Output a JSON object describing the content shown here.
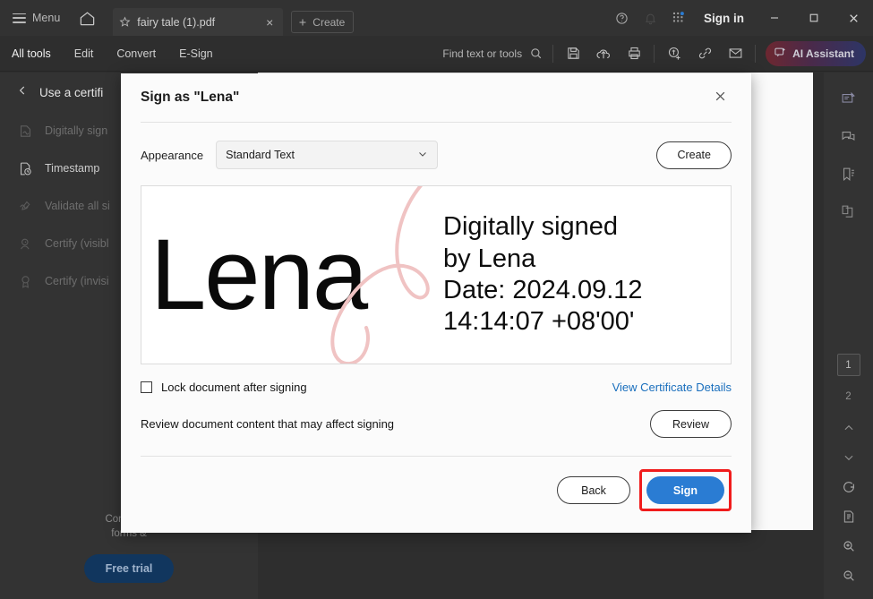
{
  "titlebar": {
    "menu_label": "Menu",
    "home_icon": "home-icon",
    "star_icon": "star-icon",
    "tab_title": "fairy tale (1).pdf",
    "tab_close": "×",
    "create_label": "Create",
    "help_icon": "help-circle-icon",
    "bell_icon": "bell-icon",
    "apps_icon": "apps-grid-icon",
    "signin_label": "Sign in",
    "minimize": "–",
    "maximize": "□",
    "close": "✕"
  },
  "toolbar": {
    "tabs": [
      {
        "label": "All tools",
        "active": true
      },
      {
        "label": "Edit",
        "active": false
      },
      {
        "label": "Convert",
        "active": false
      },
      {
        "label": "E-Sign",
        "active": false
      }
    ],
    "find_placeholder": "Find text or tools",
    "search_icon": "search-icon",
    "icons": [
      "save-icon",
      "upload-cloud-icon",
      "print-icon",
      "add-stamp-icon",
      "link-icon",
      "email-icon"
    ],
    "ai_label": "AI Assistant",
    "ai_icon": "ai-sparkle-icon"
  },
  "left_panel": {
    "back_icon": "chevron-left-icon",
    "title": "Use a certifi",
    "items": [
      {
        "label": "Digitally sign",
        "icon": "digital-sign-icon",
        "dim": true
      },
      {
        "label": "Timestamp",
        "icon": "timestamp-icon",
        "dim": false
      },
      {
        "label": "Validate all si",
        "icon": "validate-icon",
        "dim": true
      },
      {
        "label": "Certify (visibl",
        "icon": "certify-visible-icon",
        "dim": true
      },
      {
        "label": "Certify (invisi",
        "icon": "certify-invisible-icon",
        "dim": true
      }
    ],
    "promo_line1": "Convert, e",
    "promo_line2": "forms & ",
    "free_trial_label": "Free trial"
  },
  "right_rail": {
    "top_icons": [
      "edit-note-icon",
      "comment-icon",
      "bookmark-icon",
      "page-thumbnails-icon"
    ],
    "pages": [
      {
        "number": "1",
        "selected": true
      },
      {
        "number": "2",
        "selected": false
      }
    ],
    "prev_icon": "chevron-up-icon",
    "next_icon": "chevron-down-icon",
    "rotate_icon": "rotate-icon",
    "fitpage_icon": "fit-page-icon",
    "zoom_in_icon": "zoom-in-icon",
    "zoom_out_icon": "zoom-out-icon"
  },
  "modal": {
    "title": "Sign as \"Lena\"",
    "close_icon": "close-icon",
    "appearance_label": "Appearance",
    "appearance_value": "Standard Text",
    "appearance_chevron": "chevron-down-icon",
    "create_label": "Create",
    "preview": {
      "signature_name": "Lena",
      "swirl_icon": "signature-flourish-icon",
      "lines": [
        "Digitally signed",
        "by Lena",
        "Date: 2024.09.12",
        "14:14:07 +08'00'"
      ]
    },
    "lock_label": "Lock document after signing",
    "lock_checked": false,
    "cert_link_label": "View Certificate Details",
    "review_label": "Review document content that may affect signing",
    "review_btn_label": "Review",
    "back_label": "Back",
    "sign_label": "Sign"
  },
  "colors": {
    "accent_blue": "#2a7cd3",
    "link_blue": "#1a6fbd",
    "highlight_red": "#f01c1c",
    "free_trial_navy": "#11365e",
    "chrome_dark": "#2e2e2e"
  }
}
